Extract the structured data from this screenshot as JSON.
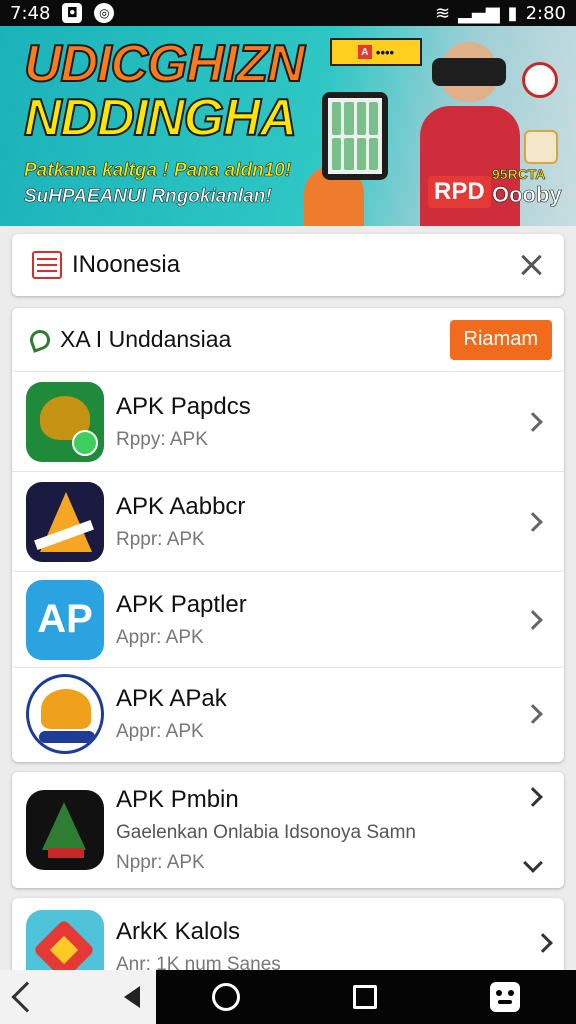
{
  "status_bar": {
    "time_left": "7:48",
    "time_right": "2:80",
    "icons": [
      "notification-square-icon",
      "notification-circle-icon",
      "wifi-icon",
      "signal-icon",
      "battery-icon"
    ]
  },
  "banner": {
    "headline_1": "UDICGHIZN",
    "headline_2": "NDDINGHA",
    "subline_1": "Patkana kaltga ! Pana aldn10!",
    "subline_2": "SuHPAEANUI Rngokianlan!",
    "badge_letter": "A",
    "rpd_label": "RPD",
    "speaker_top": "95RCTA",
    "speaker_bottom": "Oooby"
  },
  "search": {
    "query": "INoonesia",
    "flag_icon": "flag-icon",
    "clear_icon": "close-icon"
  },
  "results": {
    "header_title": "XA I Unddansiaa",
    "header_cta": "Riamam",
    "items": [
      {
        "name": "APK Papdcs",
        "subtitle": "Rppy: APK",
        "icon": "garuda-app-icon"
      },
      {
        "name": "APK Aabbcr",
        "subtitle": "Rppr: APK",
        "icon": "a-logo-app-icon"
      },
      {
        "name": "APK Paptler",
        "subtitle": "Appr: APK",
        "icon": "ap-logo-app-icon",
        "icon_text": "AP"
      },
      {
        "name": "APK APak",
        "subtitle": "Appr: APK",
        "icon": "emblem-app-icon"
      }
    ]
  },
  "featured": {
    "name": "APK Pmbin",
    "description": "Gaelenkan Onlabia Idsonoya Samn",
    "subtitle": "Nppr: APK",
    "icon": "triangle-app-icon"
  },
  "partial": {
    "name": "ArkK Kalols",
    "subtitle": "Anr: 1K num Sanes",
    "icon": "diamond-app-icon"
  },
  "nav": {
    "icons": [
      "back-icon",
      "left-triangle-icon",
      "home-icon",
      "recents-icon",
      "assistant-face-icon"
    ]
  },
  "colors": {
    "cta_orange": "#f26a1b",
    "banner_teal": "#1bb3b9",
    "headline_yellow": "#ffe600",
    "headline_orange": "#ff7a1a"
  }
}
